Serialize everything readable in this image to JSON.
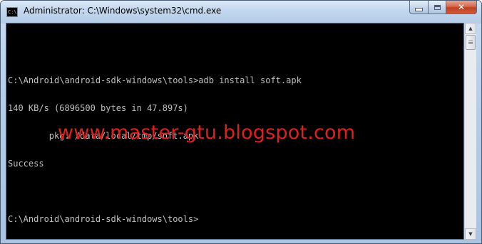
{
  "window": {
    "title": "Administrator: C:\\Windows\\system32\\cmd.exe",
    "app_icon_text": "C:\\"
  },
  "controls": {
    "minimize": "minimize",
    "maximize": "maximize",
    "close": "✕"
  },
  "console": {
    "lines": [
      "",
      "C:\\Android\\android-sdk-windows\\tools>adb install soft.apk",
      "140 KB/s (6896500 bytes in 47.897s)",
      "        pkg: /data/local/tmp/soft.apk",
      "Success",
      "",
      "C:\\Android\\android-sdk-windows\\tools>"
    ],
    "watermark": "www.master-gtu.blogspot.com"
  },
  "scrollbar": {
    "up_arrow": "▲",
    "down_arrow": "▼"
  },
  "colors": {
    "console_bg": "#000000",
    "console_text": "#c0c0c0",
    "watermark": "#e02020",
    "close_button": "#c7472a"
  }
}
